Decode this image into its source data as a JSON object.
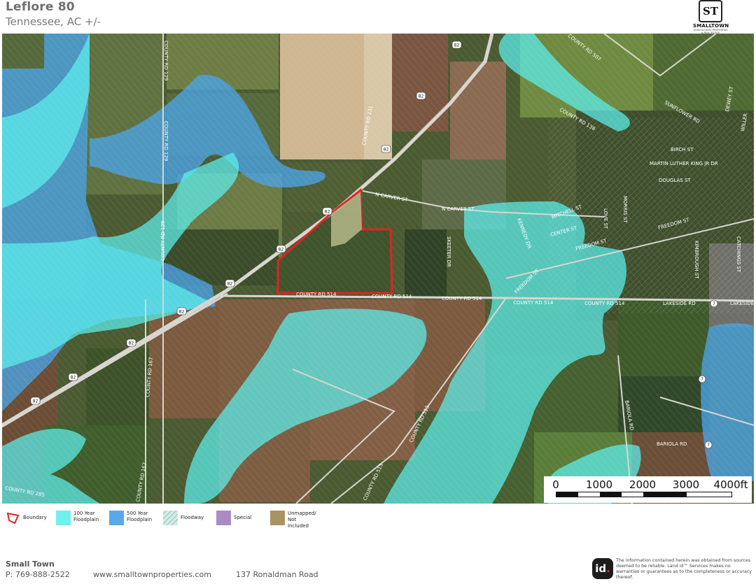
{
  "header": {
    "title": "Leflore 80",
    "subtitle": "Tennessee,  AC +/-"
  },
  "logo": {
    "monogram": "ST",
    "name": "SMALLTOWN",
    "tagline": "AGRICULTURAL PROPERTIES & REAL ESTATE"
  },
  "map": {
    "road_labels": [
      {
        "text": "COUNTY RD 507",
        "id": "cr507"
      },
      {
        "text": "COUNTY RD 129",
        "id": "cr129a"
      },
      {
        "text": "COUNTY RD 129",
        "id": "cr129b"
      },
      {
        "text": "COUNTY RD 129",
        "id": "cr129c"
      },
      {
        "text": "COUNTY RD 131",
        "id": "cr131"
      },
      {
        "text": "COUNTY RD 138",
        "id": "cr138"
      },
      {
        "text": "SUNFLOWER RD",
        "id": "sunflower"
      },
      {
        "text": "DEWEY ST",
        "id": "dewey"
      },
      {
        "text": "BIRCH ST",
        "id": "birch"
      },
      {
        "text": "MARTIN LUTHER KING JR DR",
        "id": "mlk"
      },
      {
        "text": "DOUGLAS ST",
        "id": "douglas"
      },
      {
        "text": "N CARVER ST",
        "id": "ncarver1"
      },
      {
        "text": "N CARVER ST",
        "id": "ncarver2"
      },
      {
        "text": "MITCHELL ST",
        "id": "mitchell"
      },
      {
        "text": "CENTER ST",
        "id": "center"
      },
      {
        "text": "LOVE ST",
        "id": "love"
      },
      {
        "text": "MORRIS ST",
        "id": "morris"
      },
      {
        "text": "FREEDOM ST",
        "id": "freedom1"
      },
      {
        "text": "FREEDOM ST",
        "id": "freedom2"
      },
      {
        "text": "FREEDOM ST",
        "id": "freedom3"
      },
      {
        "text": "KENNEDY DR",
        "id": "kennedy"
      },
      {
        "text": "KIMBROUGH ST",
        "id": "kimbrough"
      },
      {
        "text": "CATCHINGS ST",
        "id": "catchings"
      },
      {
        "text": "SKEETER DR",
        "id": "skeeter"
      },
      {
        "text": "COUNTY RD 514",
        "id": "cr514a"
      },
      {
        "text": "COUNTY RD 514",
        "id": "cr514b"
      },
      {
        "text": "COUNTY RD 514",
        "id": "cr514c"
      },
      {
        "text": "COUNTY RD 514",
        "id": "cr514d"
      },
      {
        "text": "COUNTY RD 514",
        "id": "cr514e"
      },
      {
        "text": "LAKESIDE RD",
        "id": "lakeside1"
      },
      {
        "text": "LAKESIDE",
        "id": "lakeside2"
      },
      {
        "text": "COUNTY RD 167",
        "id": "cr167a"
      },
      {
        "text": "COUNTY RD 167",
        "id": "cr167b"
      },
      {
        "text": "COUNTY RD 513",
        "id": "cr513a"
      },
      {
        "text": "COUNTY RD 513",
        "id": "cr513b"
      },
      {
        "text": "COUNTY RD 285",
        "id": "cr285"
      },
      {
        "text": "BARIOLA RD",
        "id": "bariola1"
      },
      {
        "text": "BARIOLA RD",
        "id": "bariola2"
      },
      {
        "text": "WILLER",
        "id": "willer"
      }
    ],
    "shields": [
      "82",
      "82",
      "82",
      "82",
      "82",
      "82",
      "82",
      "82",
      "82"
    ],
    "markers": [
      "7",
      "7",
      "7"
    ]
  },
  "scale": {
    "labels": [
      "0",
      "1000",
      "2000",
      "3000",
      "4000ft"
    ]
  },
  "legend": {
    "items": [
      {
        "label": "Boundary",
        "color": "#e32222"
      },
      {
        "label": "100 Year\nFloodplain",
        "color": "#6ff0ee"
      },
      {
        "label": "500 Year\nFloodplain",
        "color": "#5aa8e8"
      },
      {
        "label": "Floodway",
        "color": "#bcdcd8"
      },
      {
        "label": "Special",
        "color": "#a98cc6"
      },
      {
        "label": "Unmapped/\nNot Included",
        "color": "#a89461"
      }
    ]
  },
  "footer": {
    "company": "Small Town",
    "phone": "P: 769-888-2522",
    "website": "www.smalltownproperties.com",
    "address": "137 Ronaldman Road",
    "badge": "id",
    "badge_dot": ".",
    "disclaimer": "The information contained herein was obtained from sources deemed to be reliable. Land id™ Services makes no warranties or guarantees as to the completeness or accuracy thereof."
  },
  "colors": {
    "boundary": "#e32222",
    "floodplain_100": "#5cf0ee",
    "floodplain_500": "#4aa3e6",
    "field_dark": "#3f5229",
    "field_light": "#8a9a55",
    "field_brown": "#7b5a3e",
    "field_tan": "#c9b08a"
  }
}
